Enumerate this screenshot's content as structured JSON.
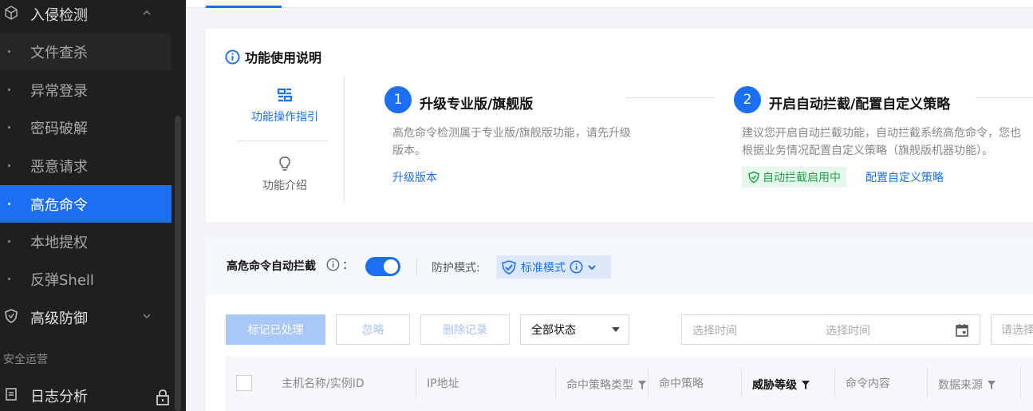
{
  "sidebar": {
    "top_item": "入侵检测",
    "sub_items": [
      "文件查杀",
      "异常登录",
      "密码破解",
      "恶意请求",
      "高危命令",
      "本地提权",
      "反弹Shell"
    ],
    "advanced_defense": "高级防御",
    "group_title": "安全运营",
    "log_analysis": "日志分析"
  },
  "info_card": {
    "title": "功能使用说明",
    "side_tabs": [
      "功能操作指引",
      "功能介绍"
    ],
    "step1": {
      "num": "1",
      "title": "升级专业版/旗舰版",
      "desc_line1": "高危命令检测属于专业版/旗舰版功能，请先升级",
      "desc_line2": "版本。",
      "link": "升级版本"
    },
    "step2": {
      "num": "2",
      "title": "开启自动拦截/配置自定义策略",
      "desc_line1": "建议您开启自动拦截功能，自动拦截系统高危命令，您也",
      "desc_line2": "根据业务情况配置自定义策略（旗舰版机器功能）。",
      "badge": "自动拦截启用中",
      "link": "配置自定义策略"
    }
  },
  "config": {
    "auto_block_label": "高危命令自动拦截",
    "colon": "：",
    "toggle_on": true,
    "mode_label": "防护模式:",
    "mode_value": "标准模式"
  },
  "toolbar": {
    "mark_processed": "标记已处理",
    "ignore": "忽略",
    "delete_records": "删除记录",
    "status_select": "全部状态",
    "date_start_placeholder": "选择时间",
    "date_end_placeholder": "选择时间",
    "search_placeholder": "请选择"
  },
  "table": {
    "headers": [
      "主机名称/实例ID",
      "IP地址",
      "命中策略类型",
      "命中策略",
      "威胁等级",
      "命令内容",
      "数据来源"
    ]
  },
  "colors": {
    "accent": "#1d6ff2",
    "sidebar_bg": "#1f1f1f",
    "success": "#24a148"
  }
}
